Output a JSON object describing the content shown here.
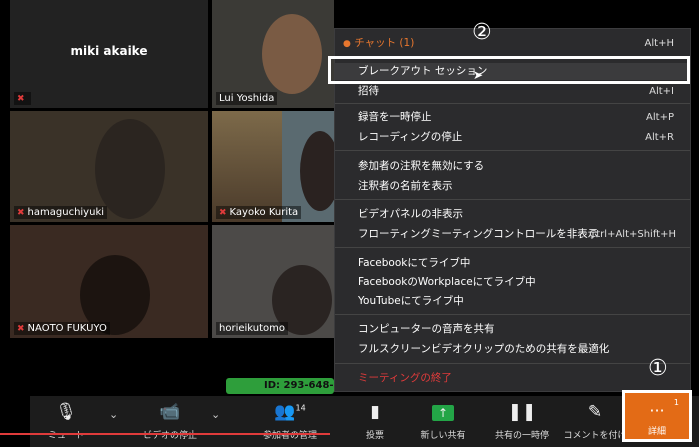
{
  "participants": [
    {
      "name": "miki akaike"
    },
    {
      "name": "Lui Yoshida"
    },
    {
      "name": "hamaguchiyuki"
    },
    {
      "name": "Kayoko Kurita"
    },
    {
      "name": "NAOTO FUKUYO"
    },
    {
      "name": "horieikutomo"
    }
  ],
  "menu": {
    "chat": {
      "label": "チャット (1)",
      "shortcut": "Alt+H"
    },
    "breakout": {
      "label": "ブレークアウト セッション"
    },
    "invite": {
      "label": "招待",
      "shortcut": "Alt+I"
    },
    "pause_rec": {
      "label": "録音を一時停止",
      "shortcut": "Alt+P"
    },
    "stop_rec": {
      "label": "レコーディングの停止",
      "shortcut": "Alt+R"
    },
    "disable_annot": {
      "label": "参加者の注釈を無効にする"
    },
    "show_annot_names": {
      "label": "注釈者の名前を表示"
    },
    "hide_video_panel": {
      "label": "ビデオパネルの非表示"
    },
    "hide_floating": {
      "label": "フローティングミーティングコントロールを非表示",
      "shortcut": "Ctrl+Alt+Shift+H"
    },
    "fb_live": {
      "label": "Facebookにてライブ中"
    },
    "fb_workplace": {
      "label": "FacebookのWorkplaceにてライブ中"
    },
    "yt_live": {
      "label": "YouTubeにてライブ中"
    },
    "share_audio": {
      "label": "コンピューターの音声を共有"
    },
    "optimize_share": {
      "label": "フルスクリーンビデオクリップのための共有を最適化"
    },
    "end_meeting": {
      "label": "ミーティングの終了"
    }
  },
  "callouts": {
    "one": "①",
    "two": "②"
  },
  "meeting_id": "ID: 293-648-",
  "toolbar": {
    "mute": "ミュート",
    "stop_video": "ビデオの停止",
    "participants": "参加者の管理",
    "participants_count": "14",
    "poll": "投票",
    "new_share": "新しい共有",
    "pause_share": "共有の一時停",
    "comment": "コメントを付け",
    "details": "詳細",
    "details_badge": "1"
  },
  "colors": {
    "accent_orange": "#e36b16",
    "chat_orange": "#e8772e",
    "mute_red": "#e03b3b",
    "share_green": "#23a547"
  }
}
